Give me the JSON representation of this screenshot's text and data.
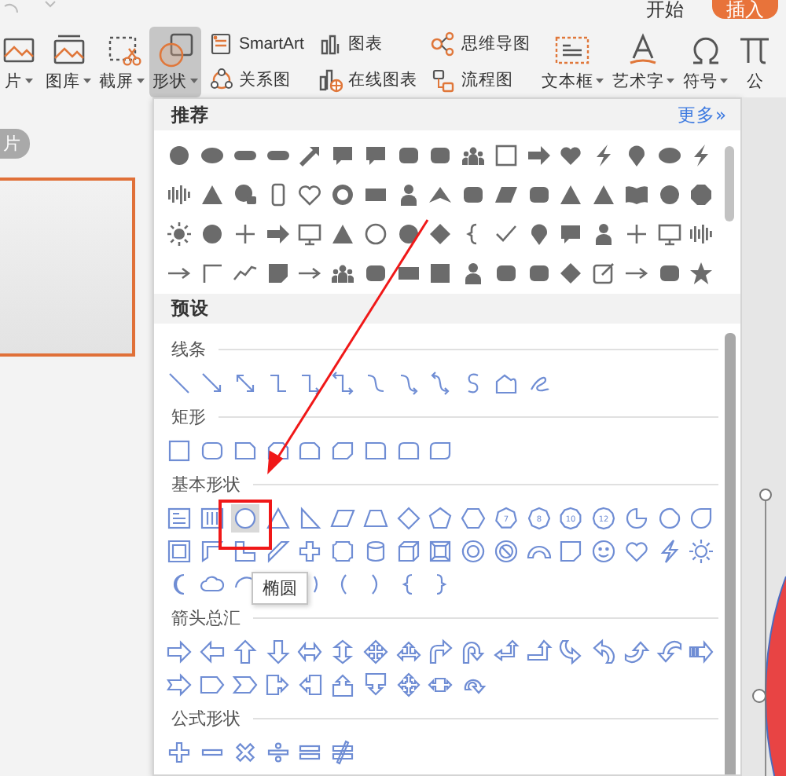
{
  "ribbon_tabs": [
    {
      "label": "开始",
      "selected": false
    },
    {
      "label": "插入",
      "selected": true
    }
  ],
  "ribbon": [
    {
      "kind": "large",
      "label": "片",
      "dropdown": true,
      "selected": false
    },
    {
      "kind": "large",
      "label": "图库",
      "dropdown": true,
      "selected": false
    },
    {
      "kind": "large",
      "label": "截屏",
      "dropdown": true,
      "selected": false
    },
    {
      "kind": "large",
      "label": "形状",
      "dropdown": true,
      "selected": true
    },
    {
      "kind": "pair",
      "items": [
        {
          "label": "SmartArt"
        },
        {
          "label": "关系图"
        }
      ]
    },
    {
      "kind": "pair",
      "items": [
        {
          "label": "图表"
        },
        {
          "label": "在线图表"
        }
      ]
    },
    {
      "kind": "pair",
      "items": [
        {
          "label": "思维导图"
        },
        {
          "label": "流程图"
        }
      ]
    },
    {
      "kind": "large",
      "label": "文本框",
      "dropdown": true,
      "selected": false
    },
    {
      "kind": "large",
      "label": "艺术字",
      "dropdown": true,
      "selected": false
    },
    {
      "kind": "large",
      "label": "符号",
      "dropdown": true,
      "selected": false
    },
    {
      "kind": "large",
      "label": "公",
      "selected": false
    }
  ],
  "slide_pane": {
    "label": "片",
    "thumbnail_selected": true
  },
  "shape_panel": {
    "title": "推荐",
    "more_link": "更多»",
    "preset_title": "预设",
    "groups": [
      {
        "title": "线条",
        "shapes": [
          {
            "selected": false
          },
          {
            "selected": false
          },
          {
            "selected": false
          },
          {
            "selected": false
          },
          {
            "selected": false
          },
          {
            "selected": false
          },
          {
            "selected": false
          },
          {
            "selected": false
          },
          {
            "selected": false
          },
          {
            "selected": false
          },
          {
            "selected": false
          },
          {
            "selected": false
          }
        ]
      },
      {
        "title": "矩形",
        "shapes": [
          {
            "selected": false
          },
          {
            "selected": false
          },
          {
            "selected": false
          },
          {
            "selected": false
          },
          {
            "selected": false
          },
          {
            "selected": false
          },
          {
            "selected": false
          },
          {
            "selected": false
          },
          {
            "selected": false
          }
        ]
      },
      {
        "title": "基本形状",
        "shapes": [
          {
            "selected": false
          },
          {
            "selected": false
          },
          {
            "selected": true
          },
          {
            "selected": false
          },
          {
            "selected": false
          },
          {
            "selected": false
          },
          {
            "selected": false
          },
          {
            "selected": false
          },
          {
            "selected": false
          },
          {
            "selected": false
          },
          {
            "selected": false,
            "label": "7"
          },
          {
            "selected": false,
            "label": "8"
          },
          {
            "selected": false,
            "label": "10"
          },
          {
            "selected": false,
            "label": "12"
          },
          {
            "selected": false
          },
          {
            "selected": false
          },
          {
            "selected": false
          },
          {
            "selected": false
          },
          {
            "selected": false
          },
          {
            "selected": false
          },
          {
            "selected": false
          },
          {
            "selected": false
          },
          {
            "selected": false
          },
          {
            "selected": false
          },
          {
            "selected": false
          },
          {
            "selected": false
          },
          {
            "selected": false
          },
          {
            "selected": false
          },
          {
            "selected": false
          },
          {
            "selected": false
          },
          {
            "selected": false
          },
          {
            "selected": false
          },
          {
            "selected": false
          },
          {
            "selected": false
          },
          {
            "selected": false
          },
          {
            "selected": false
          },
          {
            "selected": false
          },
          {
            "selected": false
          },
          {
            "selected": false
          },
          {
            "selected": false
          },
          {
            "selected": false
          },
          {
            "selected": false
          }
        ]
      },
      {
        "title": "箭头总汇",
        "shapes": [
          {
            "selected": false
          },
          {
            "selected": false
          },
          {
            "selected": false
          },
          {
            "selected": false
          },
          {
            "selected": false
          },
          {
            "selected": false
          },
          {
            "selected": false
          },
          {
            "selected": false
          },
          {
            "selected": false
          },
          {
            "selected": false
          },
          {
            "selected": false
          },
          {
            "selected": false
          },
          {
            "selected": false
          },
          {
            "selected": false
          },
          {
            "selected": false
          },
          {
            "selected": false
          },
          {
            "selected": false
          },
          {
            "selected": false
          },
          {
            "selected": false
          },
          {
            "selected": false
          },
          {
            "selected": false
          },
          {
            "selected": false
          },
          {
            "selected": false
          },
          {
            "selected": false
          },
          {
            "selected": false
          },
          {
            "selected": false
          },
          {
            "selected": false
          }
        ]
      },
      {
        "title": "公式形状",
        "shapes": [
          {
            "selected": false
          },
          {
            "selected": false
          },
          {
            "selected": false
          },
          {
            "selected": false
          },
          {
            "selected": false
          },
          {
            "selected": false
          }
        ]
      }
    ]
  },
  "tooltip": "椭圆"
}
